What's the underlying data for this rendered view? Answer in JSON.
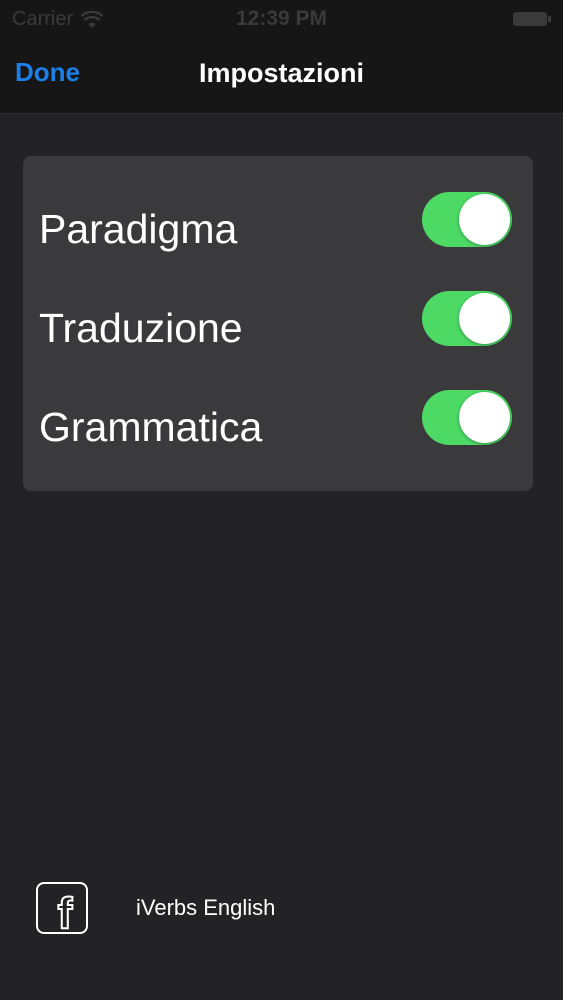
{
  "status_bar": {
    "carrier": "Carrier",
    "time": "12:39 PM",
    "icons": [
      "wifi-icon",
      "battery-icon"
    ]
  },
  "nav": {
    "done_label": "Done",
    "title": "Impostazioni"
  },
  "settings": [
    {
      "label": "Paradigma",
      "enabled": true
    },
    {
      "label": "Traduzione",
      "enabled": true
    },
    {
      "label": "Grammatica",
      "enabled": true
    }
  ],
  "footer": {
    "icon": "facebook-icon",
    "icon_letter": "f",
    "label": "iVerbs English"
  },
  "colors": {
    "accent": "#1b7fe8",
    "toggle_on": "#4cd964",
    "background": "#232325",
    "card": "#3a3a3c"
  }
}
